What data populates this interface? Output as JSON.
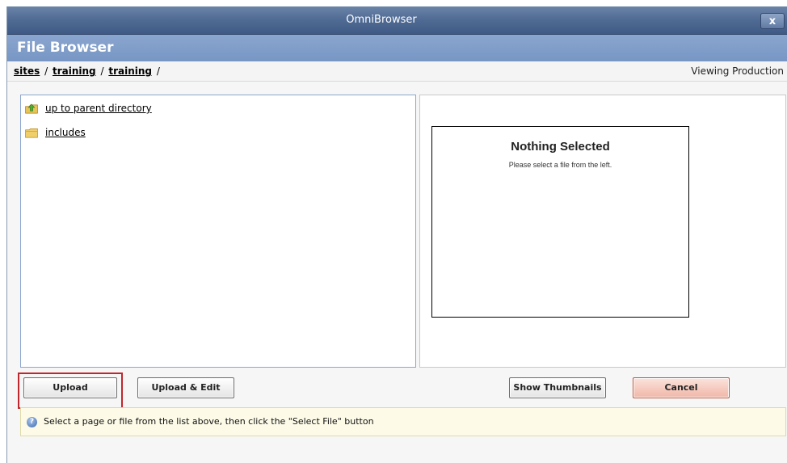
{
  "window": {
    "title": "OmniBrowser",
    "close_label": "x"
  },
  "header": {
    "title": "File Browser"
  },
  "breadcrumb": {
    "items": [
      "sites",
      "training",
      "training"
    ],
    "separator": "/",
    "trailing": "/"
  },
  "environment": {
    "label": "Viewing Production"
  },
  "file_list": {
    "items": [
      {
        "label": "up to parent directory",
        "icon": "parent-folder-icon"
      },
      {
        "label": "includes",
        "icon": "folder-icon"
      }
    ]
  },
  "preview": {
    "title": "Nothing Selected",
    "subtitle": "Please select a file from the left."
  },
  "buttons": {
    "upload": "Upload",
    "upload_edit": "Upload & Edit",
    "show_thumbnails": "Show Thumbnails",
    "cancel": "Cancel"
  },
  "status": {
    "icon": "info-icon",
    "text": "Select a page or file from the list above, then click the \"Select File\" button"
  },
  "colors": {
    "header": "#7b99c6",
    "highlight": "#c0272d",
    "status_bg": "#fdfbe8"
  }
}
